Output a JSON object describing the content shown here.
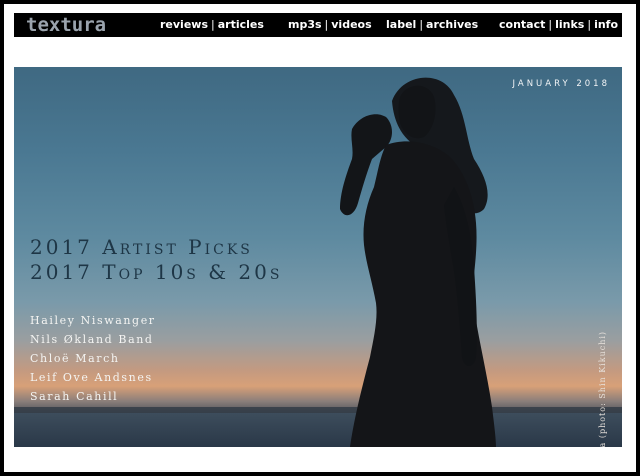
{
  "logo": "textura",
  "nav": {
    "group1": [
      "reviews",
      "articles"
    ],
    "group2": [
      "mp3s",
      "videos"
    ],
    "group3": [
      "label",
      "archives"
    ],
    "group4": [
      "contact",
      "links",
      "info"
    ]
  },
  "hero": {
    "date": "JANUARY 2018",
    "headline": [
      "2017 Artist Picks",
      "2017 Top 10s & 20s"
    ],
    "artists": [
      "Hailey Niswanger",
      "Nils Økland Band",
      "Chloë March",
      "Leif Ove Andsnes",
      "Sarah Cahill"
    ],
    "photo_credit": "Itoko Toma (photo: Shin Kikuchi)"
  },
  "colors": {
    "background": "#000000",
    "frame": "#ffffff",
    "navbar": "#000000",
    "logo": "#9aa3ad",
    "headline": "#1e3646"
  }
}
